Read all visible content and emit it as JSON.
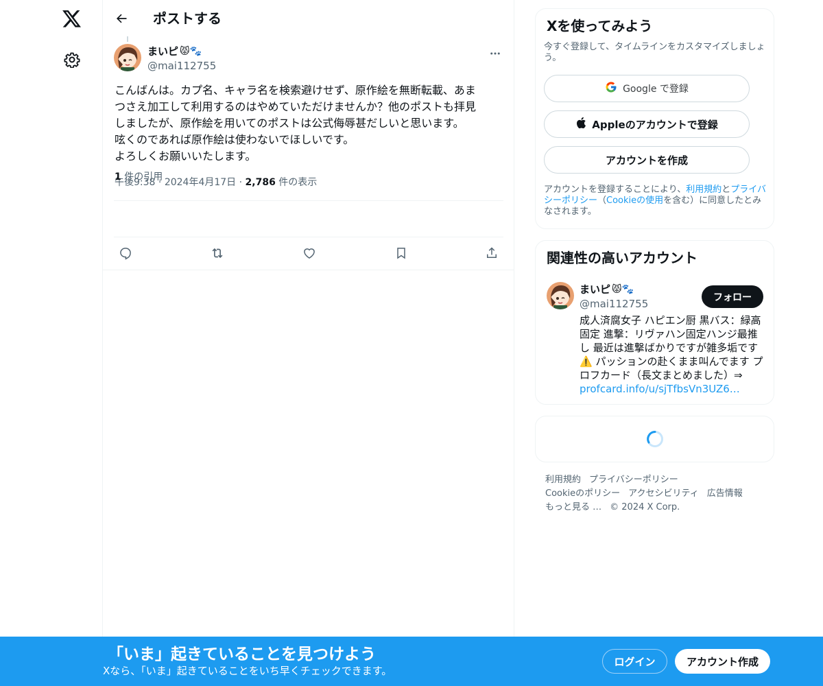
{
  "header": {
    "title": "ポストする"
  },
  "post": {
    "author_name": "まいピ",
    "author_emojis": "😾🐾",
    "handle": "@mai112755",
    "text": "こんばんは。カプ名、キャラ名を検索避けせず、原作絵を無断転載、あま\nつさえ加工して利用するのはやめていただけませんか？他のポストも拝見\nしましたが、原作絵を用いてのポストは公式侮辱甚だしいと思います。\n呟くのであれば原作絵は使わないでほしいです。\nよろしくお願いいたします。",
    "time": "午後9:38",
    "date": "2024年4月17日",
    "views_count": "2,786",
    "views_label": "件の表示",
    "quotes_count": "1",
    "quotes_label": "件の引用"
  },
  "signup_card": {
    "title": "Xを使ってみよう",
    "subtitle": "今すぐ登録して、タイムラインをカスタマイズしましょう。",
    "google_label": "Google で登録",
    "apple_label": "Appleのアカウントで登録",
    "create_label": "アカウントを作成",
    "terms_prefix": "アカウントを登録することにより、",
    "terms_link": "利用規約",
    "terms_and": "と",
    "privacy_link": "プライバシーポリシー",
    "paren_open": "（",
    "cookie_link": "Cookieの使用",
    "terms_suffix": "を含む）に同意したとみなされます。"
  },
  "relevant_accounts": {
    "title": "関連性の高いアカウント",
    "name": "まいピ",
    "emojis": "😾🐾",
    "handle": "@mai112755",
    "follow_label": "フォロー",
    "bio": "成人済腐女子 ハピエン厨 黒バス：緑高固定 進撃：リヴァハン固定ハンジ最推し 最近は進撃ばかりですが雑多垢です⚠️ パッションの赴くまま叫んでます プロフカード（長文まとめました）⇒ ",
    "bio_link": "profcard.info/u/sjTfbsVn3UZ6…"
  },
  "footer": {
    "row1": [
      "利用規約",
      "プライバシーポリシー"
    ],
    "row2": [
      "Cookieのポリシー",
      "アクセシビリティ",
      "広告情報"
    ],
    "more": "もっと見る …",
    "copyright": "© 2024 X Corp."
  },
  "bottom_bar": {
    "title": "「いま」起きていることを見つけよう",
    "subtitle": "Xなら、「いま」起きていることをいち早くチェックできます。",
    "login_label": "ログイン",
    "signup_label": "アカウント作成"
  },
  "icons": {
    "logo": "x-logo-icon",
    "settings": "gear-icon",
    "back": "arrow-left-icon",
    "more": "more-dots-icon",
    "reply": "reply-icon",
    "repost": "repost-icon",
    "like": "heart-icon",
    "bookmark": "bookmark-icon",
    "share": "share-icon"
  },
  "colors": {
    "accent": "#1d9bf0",
    "text": "#0f1419",
    "secondary": "#536471"
  }
}
